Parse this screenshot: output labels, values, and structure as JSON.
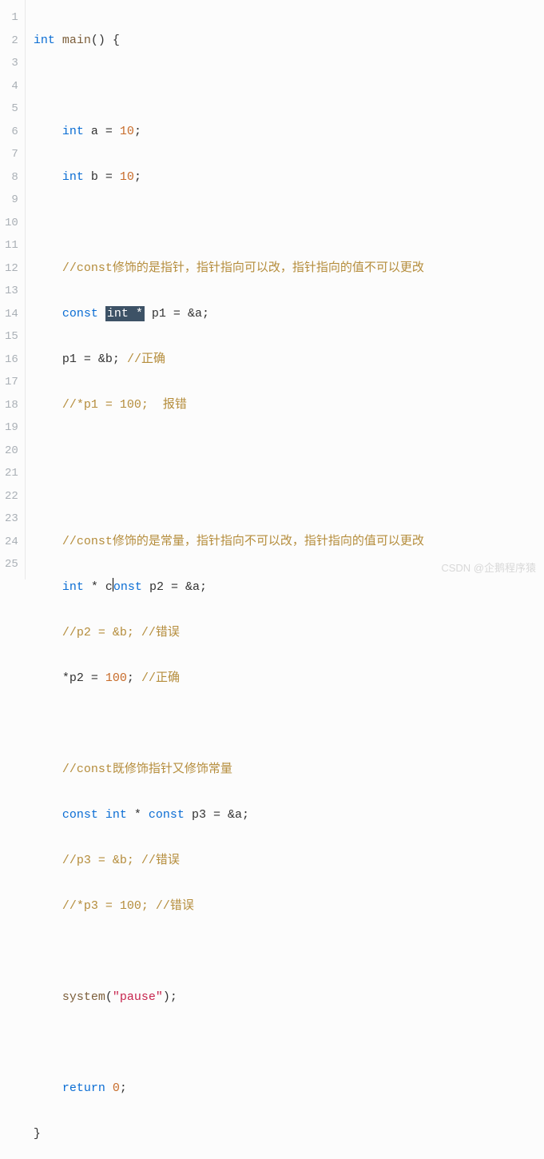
{
  "gutter": {
    "numbers": [
      "1",
      "2",
      "3",
      "4",
      "5",
      "6",
      "7",
      "8",
      "9",
      "10",
      "11",
      "12",
      "13",
      "14",
      "15",
      "16",
      "17",
      "18",
      "19",
      "20",
      "21",
      "22",
      "23",
      "24",
      "25"
    ]
  },
  "code": {
    "kw_int": "int",
    "fn_main": "main",
    "open_paren": "(",
    "close_paren": ")",
    "open_brace": "{",
    "close_brace": "}",
    "semi": ";",
    "eq": "=",
    "amp": "&",
    "star": "*",
    "a": "a",
    "b": "b",
    "p1": "p1",
    "p2": "p2",
    "p3": "p3",
    "kw_const": "const",
    "kw_return": "return",
    "fn_system": "system",
    "str_pause": "\"pause\"",
    "n10": "10",
    "n100": "100",
    "n0": "0",
    "int_star_hl": "int *",
    "cm6": "//const修饰的是指针，指针指向可以改，指针指向的值不可以更改",
    "cm8": "//正确",
    "cm9": "//*p1 = 100;  报错",
    "cm12": "//const修饰的是常量，指针指向不可以改，指针指向的值可以更改",
    "cm14": "//p2 = &b; //错误",
    "cm15": "//正确",
    "cm17": "//const既修饰指针又修饰常量",
    "cm19": "//p3 = &b; //错误",
    "cm20": "//*p3 = 100; //错误"
  },
  "watermark": "CSDN @企鹅程序猿"
}
